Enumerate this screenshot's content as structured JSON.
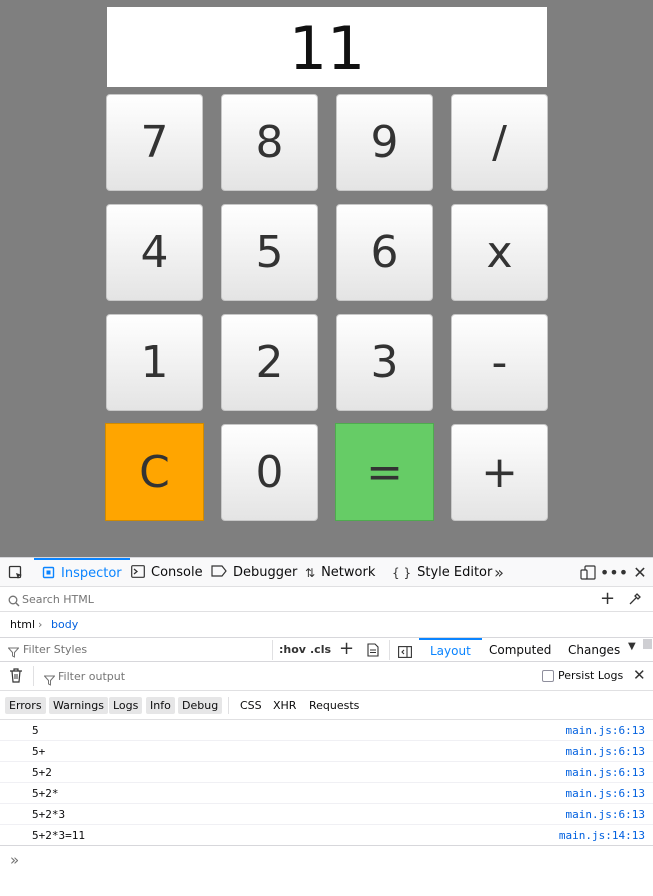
{
  "calculator": {
    "display": "11",
    "keys": [
      "7",
      "8",
      "9",
      "/",
      "4",
      "5",
      "6",
      "x",
      "1",
      "2",
      "3",
      "-",
      "C",
      "0",
      "=",
      "+"
    ],
    "colors": {
      "clear": "#ffa500",
      "equals": "#66cc66",
      "background": "#7f7f7f"
    }
  },
  "devtools": {
    "tabs": [
      {
        "label": "Inspector",
        "icon": "inspector-icon"
      },
      {
        "label": "Console",
        "icon": "console-icon"
      },
      {
        "label": "Debugger",
        "icon": "debugger-icon"
      },
      {
        "label": "Network",
        "icon": "network-icon"
      },
      {
        "label": "Style Editor",
        "icon": "style-editor-icon"
      }
    ],
    "active_tab": "Inspector",
    "search_placeholder": "Search HTML",
    "breadcrumbs": [
      "html",
      "body"
    ],
    "filter_styles_placeholder": "Filter Styles",
    "hov_label": ":hov",
    "cls_label": ".cls",
    "pane_tabs": [
      "Layout",
      "Computed",
      "Changes"
    ],
    "active_pane_tab": "Layout",
    "filter_output_placeholder": "Filter output",
    "persist_logs_label": "Persist Logs",
    "log_filters": [
      "Errors",
      "Warnings",
      "Logs",
      "Info",
      "Debug"
    ],
    "request_filters": [
      "CSS",
      "XHR",
      "Requests"
    ],
    "log_entries": [
      {
        "message": "5",
        "source": "main.js:6:13"
      },
      {
        "message": "5+",
        "source": "main.js:6:13"
      },
      {
        "message": "5+2",
        "source": "main.js:6:13"
      },
      {
        "message": "5+2*",
        "source": "main.js:6:13"
      },
      {
        "message": "5+2*3",
        "source": "main.js:6:13"
      },
      {
        "message": "5+2*3=11",
        "source": "main.js:14:13"
      }
    ],
    "accent": "#0a84ff"
  }
}
